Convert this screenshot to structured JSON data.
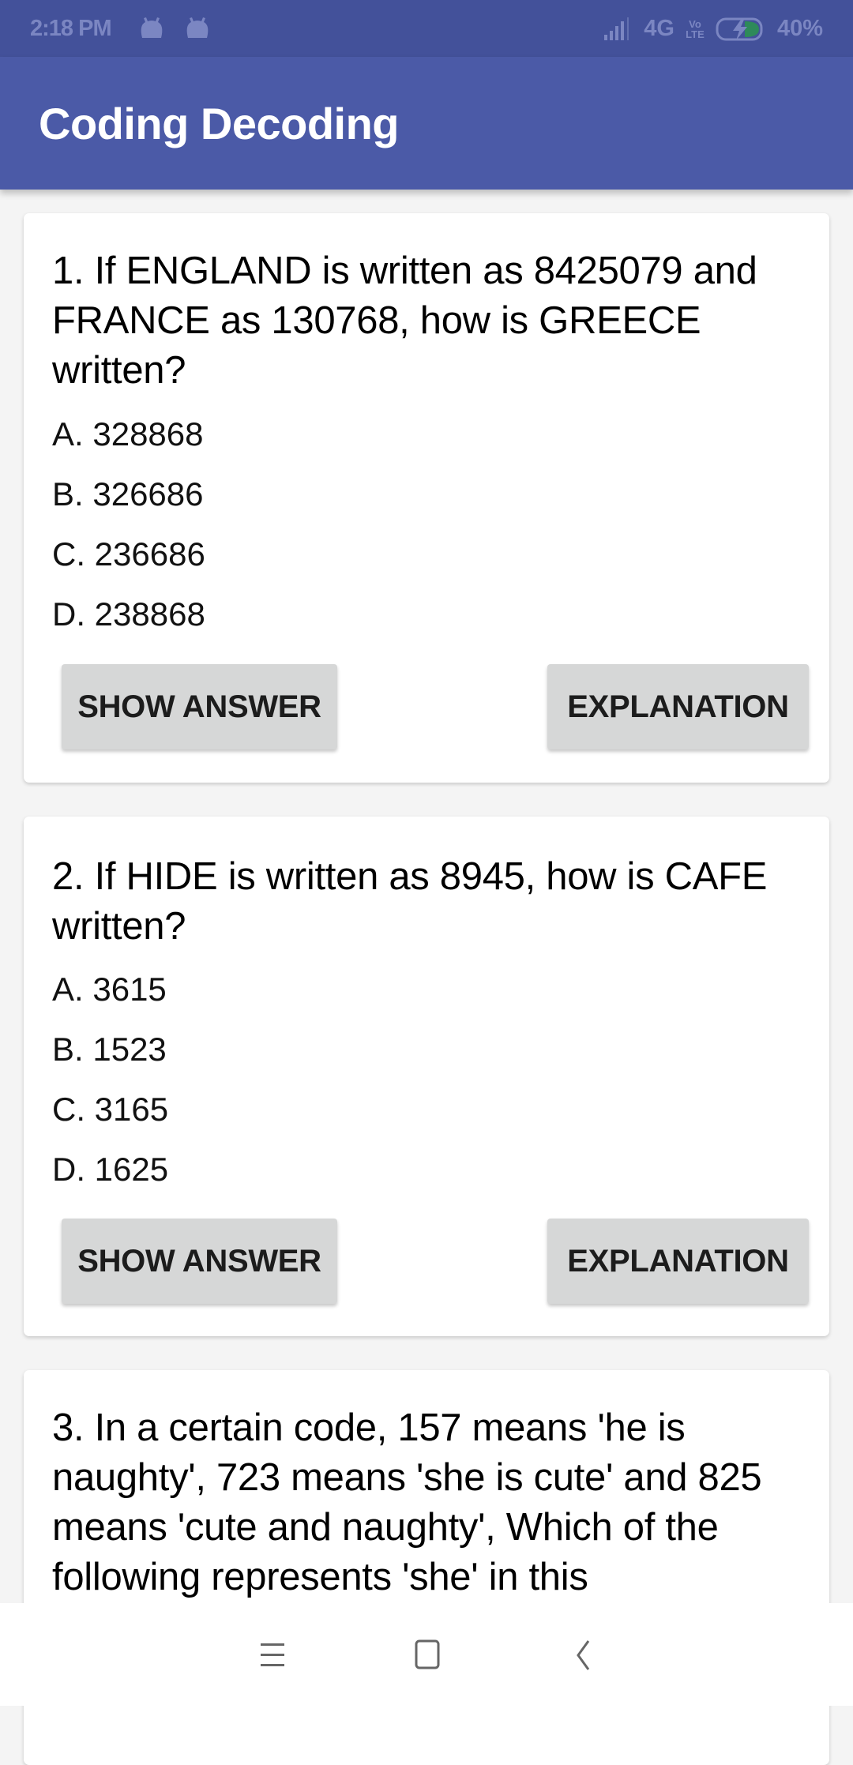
{
  "status_bar": {
    "time": "2:18 PM",
    "notification_icons": [
      "android-icon",
      "android-icon"
    ],
    "network": "4G",
    "volte": "Vo LTE",
    "battery": "40%",
    "battery_level": 0.4
  },
  "app_bar": {
    "title": "Coding Decoding"
  },
  "questions": [
    {
      "text": "1. If ENGLAND is written as 8425079 and FRANCE as 130768, how is GREECE written?",
      "options": [
        "A. 328868",
        "B. 326686",
        "C. 236686",
        "D. 238868"
      ],
      "show_answer_label": "SHOW ANSWER",
      "explanation_label": "EXPLANATION"
    },
    {
      "text": "2. If HIDE is written as 8945, how is CAFE written?",
      "options": [
        "A. 3615",
        "B. 1523",
        "C. 3165",
        "D. 1625"
      ],
      "show_answer_label": "SHOW ANSWER",
      "explanation_label": "EXPLANATION"
    },
    {
      "text": "3. In a certain code, 157 means 'he is naughty', 723 means 'she is cute' and 825 means 'cute and naughty', Which of the following represents 'she' in this"
    }
  ],
  "nav_bar": {
    "buttons": [
      "menu",
      "home",
      "back"
    ]
  },
  "colors": {
    "primary": "#4b5aa7",
    "primary_dark": "#43519a",
    "button": "#d6d7d7",
    "background": "#f4f4f4"
  }
}
